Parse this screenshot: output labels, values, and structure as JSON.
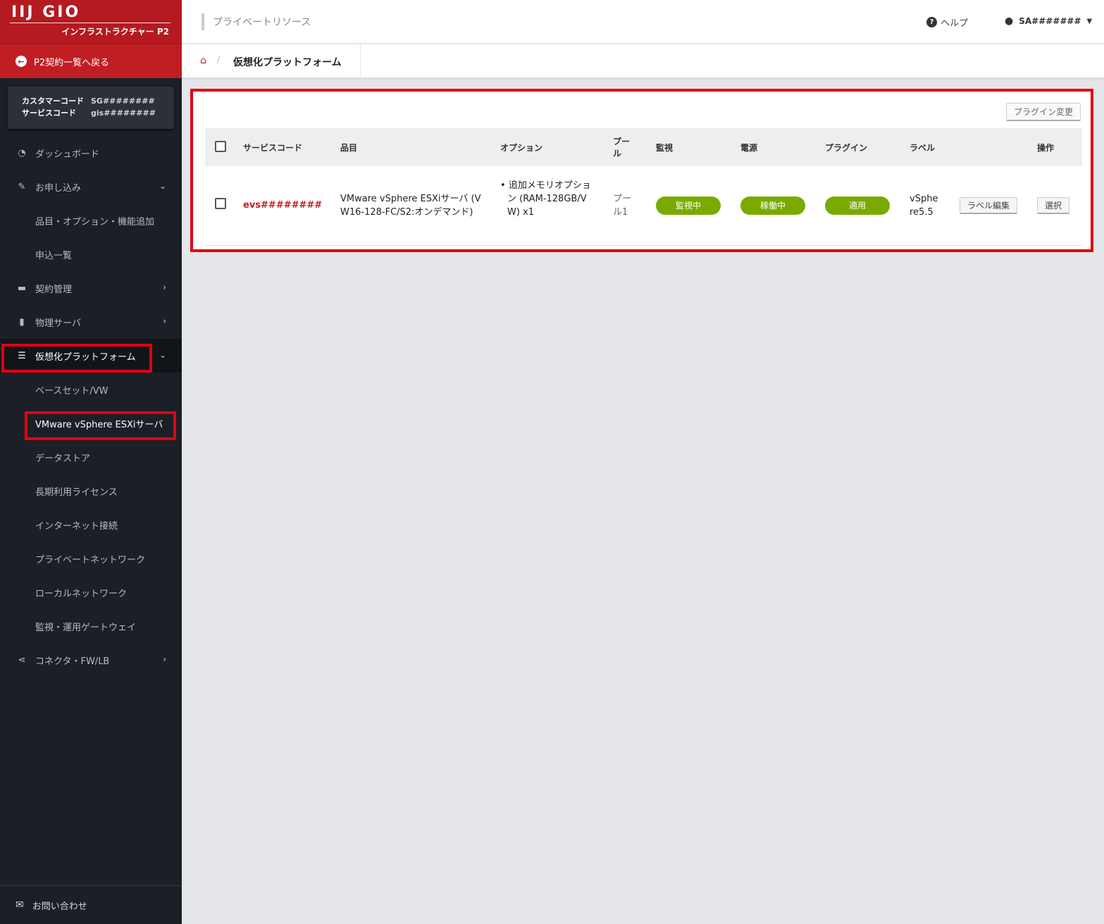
{
  "brand": {
    "name": "IIJ GIO",
    "subtitle": "インフラストラクチャー P2"
  },
  "back_link": "P2契約一覧へ戻る",
  "codes": {
    "customer_label": "カスタマーコード",
    "customer_value": "SG########",
    "service_label": "サービスコード",
    "service_value": "gis########"
  },
  "nav": {
    "dashboard": "ダッシュボード",
    "apply": "お申し込み",
    "apply_items": "品目・オプション・機能追加",
    "apply_list": "申込一覧",
    "contract": "契約管理",
    "physical": "物理サーバ",
    "virtual": "仮想化プラットフォーム",
    "baseset": "ベースセット/VW",
    "esxi": "VMware vSphere ESXiサーバ",
    "datastore": "データストア",
    "license": "長期利用ライセンス",
    "internet": "インターネット接続",
    "private_net": "プライベートネットワーク",
    "local_net": "ローカルネットワーク",
    "gateway": "監視・運用ゲートウェイ",
    "connector": "コネクタ・FW/LB"
  },
  "contact": "お問い合わせ",
  "header": {
    "title": "プライベートリソース",
    "help": "ヘルプ",
    "user": "SA#######"
  },
  "breadcrumb": {
    "current": "仮想化プラットフォーム"
  },
  "panel": {
    "plugin_change": "プラグイン変更",
    "columns": {
      "service_code": "サービスコード",
      "item": "品目",
      "option": "オプション",
      "pool_l1": "プー",
      "pool_l2": "ル",
      "monitor": "監視",
      "power": "電源",
      "plugin": "プラグイン",
      "label": "ラベル",
      "operation": "操作"
    },
    "row": {
      "service_code": "evs########",
      "item_l1": "VMware vSphere ESXiサーバ (V",
      "item_l2": "W16-128-FC/S2:オンデマンド)",
      "option_l1": "追加メモリオプショ",
      "option_l2": "ン (RAM-128GB/V",
      "option_l3": "W) x1",
      "pool_l1": "プー",
      "pool_l2": "ル1",
      "monitor": "監視中",
      "power": "稼働中",
      "plugin": "適用",
      "label_l1": "vSphe",
      "label_l2": "re5.5",
      "label_edit": "ラベル編集",
      "select": "選択"
    }
  },
  "colors": {
    "brand_red": "#b51a20",
    "status_green": "#7aaa00",
    "highlight_red": "#e30011",
    "sidebar_bg": "#1b1f26"
  }
}
